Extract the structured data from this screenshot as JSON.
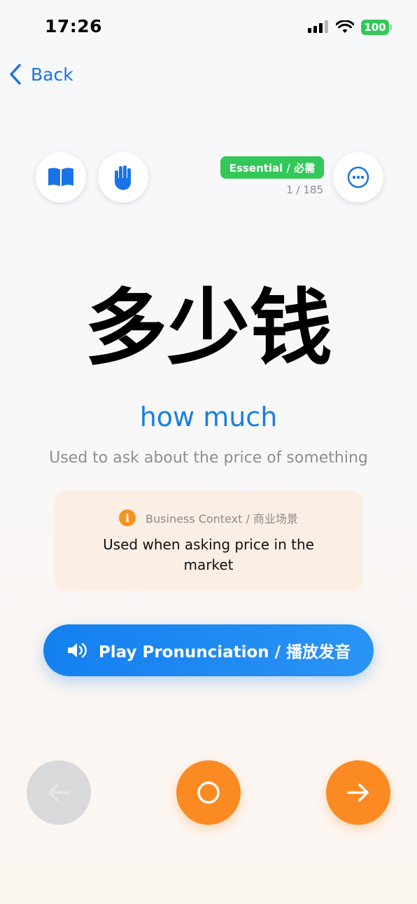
{
  "status_bar": {
    "time": "17:26",
    "battery": "100"
  },
  "nav": {
    "back_label": "Back"
  },
  "card": {
    "badge": "Essential / 必需",
    "counter": "1 / 185",
    "word": "多少钱",
    "translation": "how much",
    "description": "Used to ask about the price of something"
  },
  "context": {
    "title": "Business Context / 商业场景",
    "text": "Used when asking price in the market"
  },
  "play_button": {
    "label": "Play Pronunciation / 播放发音"
  },
  "icons": {
    "book": "book-icon",
    "hand": "hand-icon",
    "more": "more-icon",
    "speaker": "speaker-icon",
    "prev": "arrow-left-icon",
    "circle": "circle-icon",
    "next": "arrow-right-icon"
  },
  "colors": {
    "accent": "#1a73e8",
    "badge_green": "#34c759",
    "orange": "#fc8a23",
    "context_bg": "#fbeee4"
  }
}
